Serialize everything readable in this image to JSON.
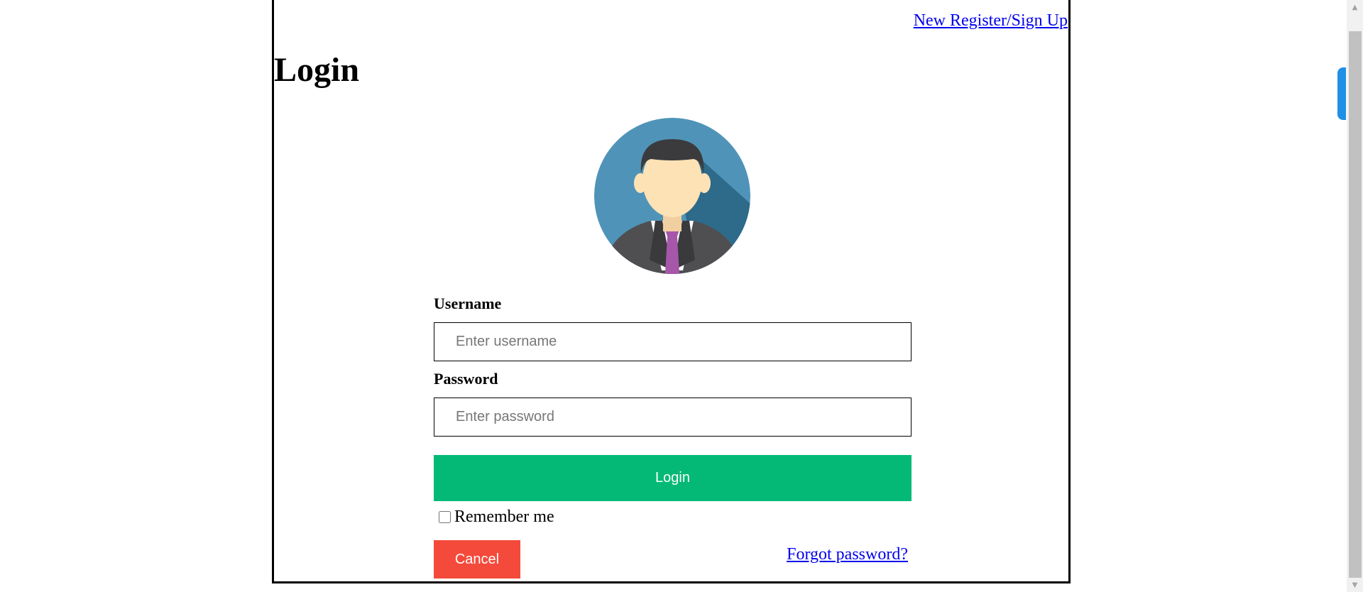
{
  "header": {
    "signup_link": "New Register/Sign Up",
    "title": "Login"
  },
  "avatar": {
    "icon": "businessman-avatar-icon",
    "colors": {
      "background": "#4f94b8",
      "shadow": "#2e6a89",
      "skin": "#fde2b6",
      "hair": "#3b3b3d",
      "suit": "#4f4f52",
      "tie": "#a657a9"
    }
  },
  "form": {
    "username_label": "Username",
    "username_placeholder": "Enter username",
    "username_value": "",
    "password_label": "Password",
    "password_placeholder": "Enter password",
    "password_value": "",
    "login_button": "Login",
    "remember_label": "Remember me",
    "remember_checked": false,
    "cancel_button": "Cancel",
    "forgot_link": "Forgot password?"
  },
  "colors": {
    "login_button": "#04b976",
    "cancel_button": "#f44a3b",
    "link": "#0000ee"
  }
}
